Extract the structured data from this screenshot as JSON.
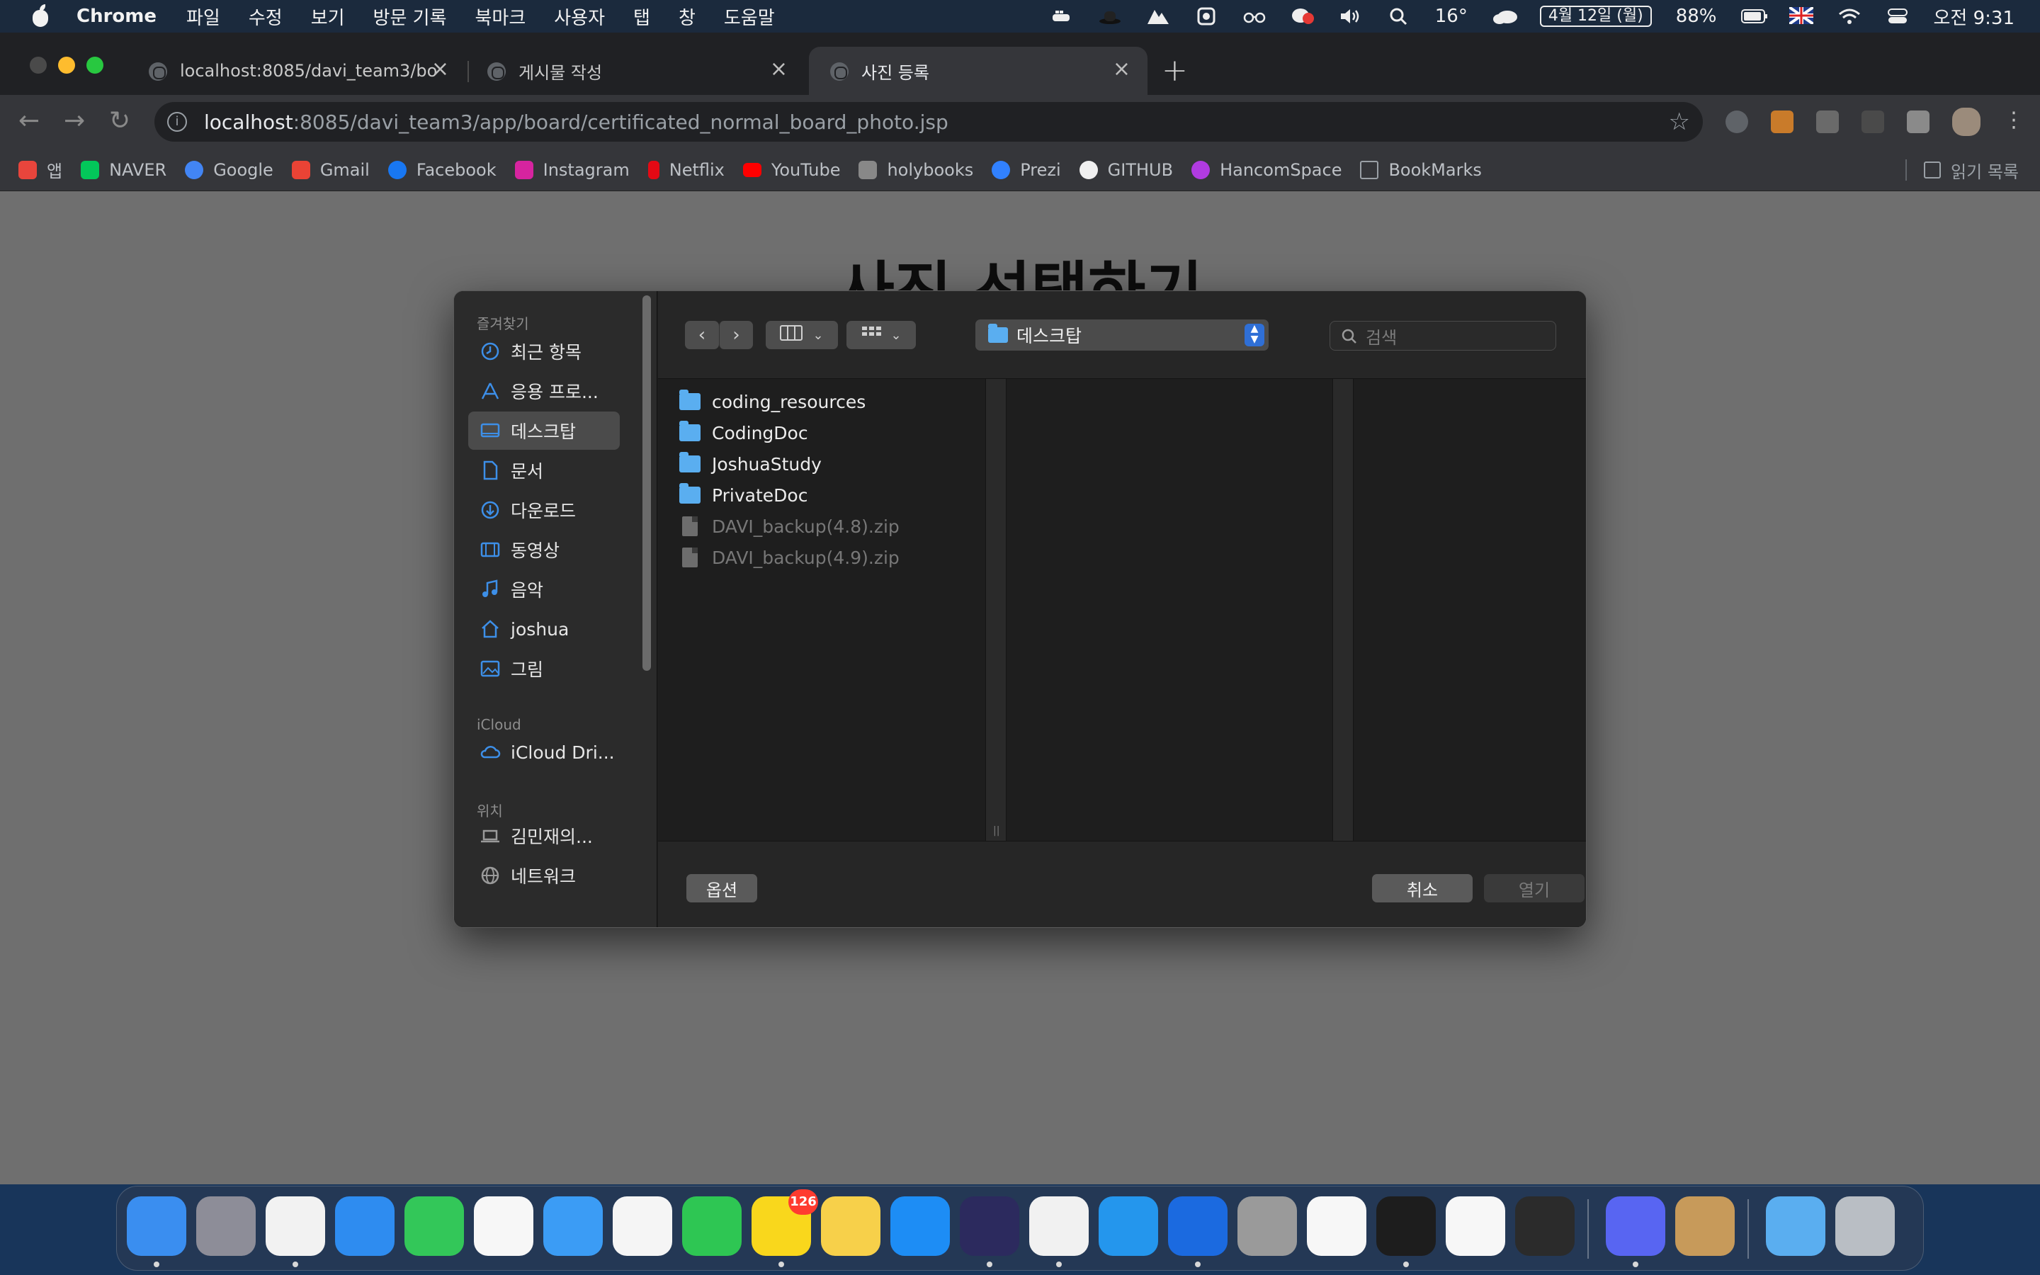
{
  "menubar": {
    "app_name": "Chrome",
    "menus": [
      "파일",
      "수정",
      "보기",
      "방문 기록",
      "북마크",
      "사용자",
      "탭",
      "창",
      "도움말"
    ],
    "temperature": "16°",
    "date": "4월 12일 (월)",
    "battery": "88%",
    "time": "오전 9:31"
  },
  "tabs": [
    {
      "title": "localhost:8085/davi_team3/bo",
      "active": false
    },
    {
      "title": "게시물 작성",
      "active": false
    },
    {
      "title": "사진 등록",
      "active": true
    }
  ],
  "address_bar": {
    "host": "localhost",
    "path": ":8085/davi_team3/app/board/certificated_normal_board_photo.jsp"
  },
  "bookmarks": [
    {
      "label": "앱",
      "icon": "apps-grid-icon",
      "color": "#e8453c"
    },
    {
      "label": "NAVER",
      "icon": "naver-icon",
      "color": "#03c75a"
    },
    {
      "label": "Google",
      "icon": "google-icon",
      "color": "#4285f4"
    },
    {
      "label": "Gmail",
      "icon": "gmail-icon",
      "color": "#ea4335"
    },
    {
      "label": "Facebook",
      "icon": "facebook-icon",
      "color": "#1877f2"
    },
    {
      "label": "Instagram",
      "icon": "instagram-icon",
      "color": "#d6249f"
    },
    {
      "label": "Netflix",
      "icon": "netflix-icon",
      "color": "#e50914"
    },
    {
      "label": "YouTube",
      "icon": "youtube-icon",
      "color": "#ff0000"
    },
    {
      "label": "holybooks",
      "icon": "holybooks-icon",
      "color": "#888888"
    },
    {
      "label": "Prezi",
      "icon": "prezi-icon",
      "color": "#3181ff"
    },
    {
      "label": "GITHUB",
      "icon": "github-icon",
      "color": "#f0f0f0"
    },
    {
      "label": "HancomSpace",
      "icon": "hancom-icon",
      "color": "#b03be0"
    },
    {
      "label": "BookMarks",
      "icon": "folder-icon",
      "color": "#9aa0a6"
    }
  ],
  "reading_list": "읽기 목록",
  "page": {
    "heading": "사진 선택하기"
  },
  "dialog": {
    "sidebar": {
      "favorites_header": "즐겨찾기",
      "favorites": [
        {
          "label": "최근 항목",
          "icon": "clock-icon",
          "selected": false
        },
        {
          "label": "응용 프로...",
          "icon": "applications-icon",
          "selected": false
        },
        {
          "label": "데스크탑",
          "icon": "desktop-icon",
          "selected": true
        },
        {
          "label": "문서",
          "icon": "document-icon",
          "selected": false
        },
        {
          "label": "다운로드",
          "icon": "download-icon",
          "selected": false
        },
        {
          "label": "동영상",
          "icon": "film-icon",
          "selected": false
        },
        {
          "label": "음악",
          "icon": "music-icon",
          "selected": false
        },
        {
          "label": "joshua",
          "icon": "home-icon",
          "selected": false
        },
        {
          "label": "그림",
          "icon": "picture-icon",
          "selected": false
        }
      ],
      "icloud_header": "iCloud",
      "icloud": [
        {
          "label": "iCloud Dri...",
          "icon": "cloud-icon"
        }
      ],
      "locations_header": "위치",
      "locations": [
        {
          "label": "김민재의...",
          "icon": "laptop-icon"
        },
        {
          "label": "네트워크",
          "icon": "network-icon"
        }
      ]
    },
    "current_folder": "데스크탑",
    "search_placeholder": "검색",
    "files": [
      {
        "name": "coding_resources",
        "type": "folder"
      },
      {
        "name": "CodingDoc",
        "type": "folder"
      },
      {
        "name": "JoshuaStudy",
        "type": "folder"
      },
      {
        "name": "PrivateDoc",
        "type": "folder"
      },
      {
        "name": "DAVI_backup(4.8).zip",
        "type": "file"
      },
      {
        "name": "DAVI_backup(4.9).zip",
        "type": "file"
      }
    ],
    "options_label": "옵션",
    "cancel_label": "취소",
    "open_label": "열기"
  },
  "dock": {
    "apps": [
      {
        "name": "finder",
        "color": "#3a8ef0",
        "running": true
      },
      {
        "name": "launchpad",
        "color": "#8d8d98",
        "running": false
      },
      {
        "name": "chrome",
        "color": "#f2f2f2",
        "running": true
      },
      {
        "name": "safari",
        "color": "#2e8cf0",
        "running": false
      },
      {
        "name": "messages",
        "color": "#33c759",
        "running": false
      },
      {
        "name": "reminders",
        "color": "#f7f7f7",
        "running": false
      },
      {
        "name": "mail",
        "color": "#3b9cf5",
        "running": false
      },
      {
        "name": "photos",
        "color": "#f5f5f5",
        "running": false
      },
      {
        "name": "facetime",
        "color": "#2ec653",
        "running": false
      },
      {
        "name": "kakaotalk",
        "color": "#f9d71c",
        "running": true,
        "badge": "126"
      },
      {
        "name": "notes",
        "color": "#f7d04a",
        "running": false
      },
      {
        "name": "app-store",
        "color": "#1d8df5",
        "running": false
      },
      {
        "name": "eclipse",
        "color": "#2c2a5e",
        "running": true
      },
      {
        "name": "pycharm",
        "color": "#f1f1f1",
        "running": true
      },
      {
        "name": "docker",
        "color": "#2496ed",
        "running": false
      },
      {
        "name": "sourcetree",
        "color": "#1b6ae0",
        "running": true
      },
      {
        "name": "git-helmet",
        "color": "#9a9a9a",
        "running": false
      },
      {
        "name": "app-green-ring",
        "color": "#f7f7f7",
        "running": false
      },
      {
        "name": "terminal",
        "color": "#1d1d1d",
        "running": true
      },
      {
        "name": "slack",
        "color": "#f7f7f7",
        "running": false
      },
      {
        "name": "final-cut",
        "color": "#2b2b2b",
        "running": false
      },
      {
        "name": "discord",
        "color": "#5865f2",
        "running": true
      },
      {
        "name": "archiver",
        "color": "#c79a5a",
        "running": false
      },
      {
        "name": "downloads-stack",
        "color": "#5aaef0",
        "running": false
      },
      {
        "name": "trash",
        "color": "#b9bec4",
        "running": false
      }
    ]
  }
}
